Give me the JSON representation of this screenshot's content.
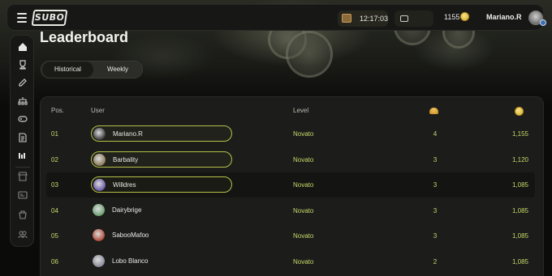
{
  "header": {
    "logo": "SUBO",
    "timer": "12:17:03",
    "coins": "1155",
    "username": "Mariano.R",
    "icons": {
      "menu": "menu-icon",
      "chest": "chest-icon",
      "ticket": "ticket-icon",
      "coin": "coin-icon"
    }
  },
  "sidebar": {
    "items": [
      "home-icon",
      "trophy-icon",
      "edit-icon",
      "org-chart-icon",
      "gamepad-icon",
      "document-icon",
      "bar-chart-icon",
      "store-icon",
      "id-card-icon",
      "bag-icon",
      "users-icon"
    ]
  },
  "page": {
    "title": "Leaderboard",
    "tabs": [
      {
        "label": "Historical",
        "active": true
      },
      {
        "label": "Weekly",
        "active": false
      }
    ]
  },
  "table": {
    "headers": {
      "pos": "Pos.",
      "user": "User",
      "level": "Level",
      "wins_icon": "cup-icon",
      "score_icon": "coin-icon"
    },
    "rows": [
      {
        "pos": "01",
        "user": "Mariano.R",
        "level": "Novato",
        "wins": "4",
        "score": "1,155",
        "highlight": true,
        "avatar_color": "#3c3c3c"
      },
      {
        "pos": "02",
        "user": "Barbality",
        "level": "Novato",
        "wins": "3",
        "score": "1,120",
        "highlight": true,
        "avatar_color": "#8a7a5a"
      },
      {
        "pos": "03",
        "user": "Willdres",
        "level": "Novato",
        "wins": "3",
        "score": "1,085",
        "highlight": true,
        "avatar_color": "#6a5aa8"
      },
      {
        "pos": "04",
        "user": "Dairybrige",
        "level": "Novato",
        "wins": "3",
        "score": "1,085",
        "highlight": false,
        "avatar_color": "#6aa070"
      },
      {
        "pos": "05",
        "user": "SabooMafoo",
        "level": "Novato",
        "wins": "3",
        "score": "1,085",
        "highlight": false,
        "avatar_color": "#b04a3a"
      },
      {
        "pos": "06",
        "user": "Lobo Blanco",
        "level": "Novato",
        "wins": "2",
        "score": "1,085",
        "highlight": false,
        "avatar_color": "#8a8a9a"
      }
    ]
  }
}
